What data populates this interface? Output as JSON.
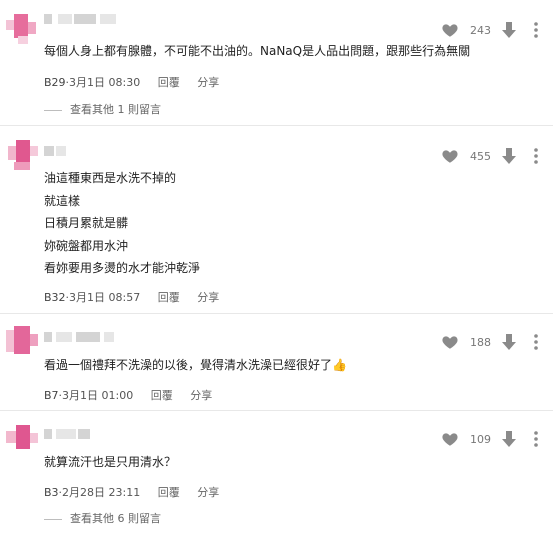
{
  "comments": [
    {
      "likes": "243",
      "lines": [
        "每個人身上都有腺體，不可能不出油的。NaNaQ是人品出問題，跟那些行為無關"
      ],
      "floor": "B29",
      "time": "3月1日 08:30",
      "reply_label": "回覆",
      "share_label": "分享",
      "replies": "查看其他 1 則留言"
    },
    {
      "likes": "455",
      "lines": [
        "油這種東西是水洗不掉的",
        "就這樣",
        "日積月累就是髒",
        "妳碗盤都用水沖",
        "看妳要用多燙的水才能沖乾淨"
      ],
      "floor": "B32",
      "time": "3月1日 08:57",
      "reply_label": "回覆",
      "share_label": "分享"
    },
    {
      "likes": "188",
      "lines": [
        "看過一個禮拜不洗澡的以後，覺得清水洗澡已經很好了"
      ],
      "floor": "B7",
      "time": "3月1日 01:00",
      "reply_label": "回覆",
      "share_label": "分享"
    },
    {
      "likes": "109",
      "lines": [
        "就算流汗也是只用清水？"
      ],
      "floor": "B3",
      "time": "2月28日 23:11",
      "reply_label": "回覆",
      "share_label": "分享",
      "replies": "查看其他 6 則留言"
    }
  ],
  "icons": {
    "like": "heart-icon",
    "dislike": "arrow-down-icon",
    "more": "more-vertical-icon",
    "thumbs_up": "thumbs-up-emoji"
  },
  "colors": {
    "avatar_pink": "#e0588f",
    "avatar_light": "#f2b3cc",
    "icon_gray": "#8a8a8a"
  }
}
